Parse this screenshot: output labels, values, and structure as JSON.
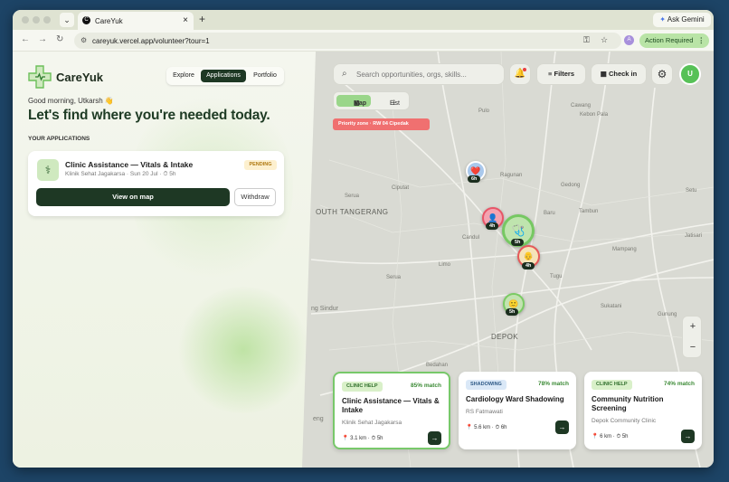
{
  "browser": {
    "tab_title": "CareYuk",
    "tab_favicon": "C",
    "gemini_label": "Ask Gemini",
    "url": "careyuk.vercel.app/volunteer?tour=1",
    "profile_initial": "A",
    "action_required": "Action Required"
  },
  "brand": {
    "name": "CareYuk",
    "accent": "#1e3824",
    "green": "#57c157"
  },
  "nav": {
    "explore": "Explore",
    "applications": "Applications",
    "portfolio": "Portfolio",
    "active": "Applications"
  },
  "greeting": "Good morning, Utkarsh 👋",
  "headline": "Let's find where you're needed today.",
  "section_title": "YOUR APPLICATIONS",
  "application": {
    "title": "Clinic Assistance — Vitals & Intake",
    "subtitle": "Klinik Sehat Jagakarsa · Sun 20 Jul · ⏱ 5h",
    "status": "PENDING",
    "view_label": "View on map",
    "withdraw_label": "Withdraw"
  },
  "toolbar": {
    "search_placeholder": "Search opportunities, orgs, skills...",
    "filters": "Filters",
    "checkin": "Check in",
    "user_initial": "U"
  },
  "view_toggle": {
    "map": "Map",
    "list": "List",
    "active": "Map"
  },
  "priority_zone": "Priority zone · RW 04 Cipedak",
  "zoom": {
    "in": "+",
    "out": "−"
  },
  "map": {
    "pins": [
      {
        "emoji": "❤️",
        "hours": "6h"
      },
      {
        "emoji": "👤",
        "hours": "4h"
      },
      {
        "emoji": "🩺",
        "hours": "5h"
      },
      {
        "emoji": "👴",
        "hours": "4h"
      },
      {
        "emoji": "🙂",
        "hours": "5h"
      }
    ],
    "places": {
      "pulo": "Pulo",
      "cawang": "Cawang",
      "kebon_pala": "Kebon Pala",
      "ragunan": "Ragunan",
      "gedong": "Gedong",
      "setu": "Setu",
      "serua": "Serua",
      "ciputat": "Ciputat",
      "tambun": "Tambun",
      "candul": "Candul",
      "baru": "Baru",
      "limo": "Limo",
      "tugu": "Tugu",
      "mampang": "Mampang",
      "jatisari": "Jatisari",
      "sirua": "Serua",
      "sukatani": "Sukatani",
      "gunung": "Gunung",
      "bedahan": "Bedahan",
      "ageng": "eng"
    },
    "cities": {
      "south_tangerang": "OUTH TANGERANG",
      "depok": "DEPOK",
      "sindur": "ng Sindur"
    }
  },
  "cards": [
    {
      "badge": "CLINIC HELP",
      "match": "85% match",
      "title": "Clinic Assistance — Vitals & Intake",
      "org": "Klinik Sehat Jagakarsa",
      "distance": "📍 3.1 km · ⏱ 5h"
    },
    {
      "badge": "SHADOWING",
      "match": "78% match",
      "title": "Cardiology Ward Shadowing",
      "org": "RS Fatmawati",
      "distance": "📍 5.6 km · ⏱ 6h"
    },
    {
      "badge": "CLINIC HELP",
      "match": "74% match",
      "title": "Community Nutrition Screening",
      "org": "Depok Community Clinic",
      "distance": "📍 6 km · ⏱ 5h"
    }
  ],
  "icons": [
    "search-icon",
    "bell-icon",
    "filter-icon",
    "checkin-icon",
    "gear-icon",
    "map-icon",
    "list-icon",
    "pin-icon",
    "arrow-right-icon",
    "stethoscope-icon",
    "logo-cross-icon"
  ]
}
